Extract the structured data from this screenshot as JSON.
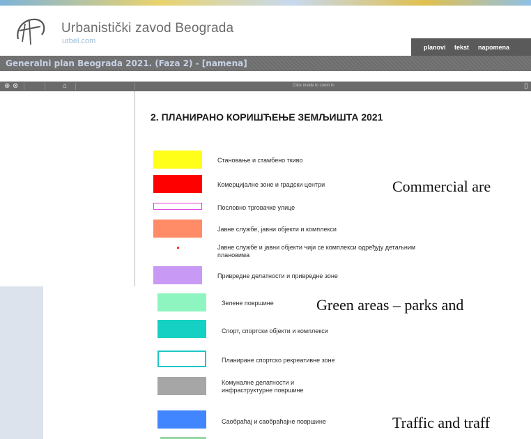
{
  "header": {
    "site_title": "Urbanistički zavod Beograda",
    "site_url": "urbel.com",
    "nav": [
      "planovi",
      "tekst",
      "napomena"
    ]
  },
  "titlebar": {
    "title": "Generalni plan Beograda 2021. (Faza 2) - [namena]"
  },
  "toolbar": {
    "hint": "Click inside to zoom in"
  },
  "legend": {
    "title": "2. ПЛАНИРАНО КОРИШЋЕЊЕ ЗЕМЉИШТА 2021",
    "items": [
      {
        "label": "Становање и стамбено ткиво",
        "color": "#ffff1a"
      },
      {
        "label": "Комерцијалне зоне и  градски центри",
        "color": "#ff0000"
      },
      {
        "label": "Пословно трговачке улице",
        "color": "#ffffff",
        "border": "#e040e0"
      },
      {
        "label": "Јавне службе, јавни објекти и комплекси",
        "color": "#ff8c66"
      },
      {
        "label": "Јавне службе и јавни објекти чији се комплекси одређују детаљним плановима",
        "color": "#ffffff",
        "dot": "#ff3333"
      },
      {
        "label": "Привредне делатности и привредне зоне",
        "color": "#c89af5"
      },
      {
        "label": "Зелене површине",
        "color": "#8ff5c0"
      },
      {
        "label": "Спорт, спортски објекти и комплекси",
        "color": "#14d1c4"
      },
      {
        "label": "Планиране спортско рекреативне зоне",
        "color": "#ffffff",
        "border": "#1cc6c6"
      },
      {
        "label": "Комуналне делатности и инфраструктурне површине",
        "color": "#a6a6a6"
      },
      {
        "label": "Саобраћај и саобраћајне површине",
        "color": "#4286ff"
      }
    ]
  },
  "annotations": [
    "Commercial are",
    "Green areas – parks and",
    "Traffic and traff"
  ]
}
